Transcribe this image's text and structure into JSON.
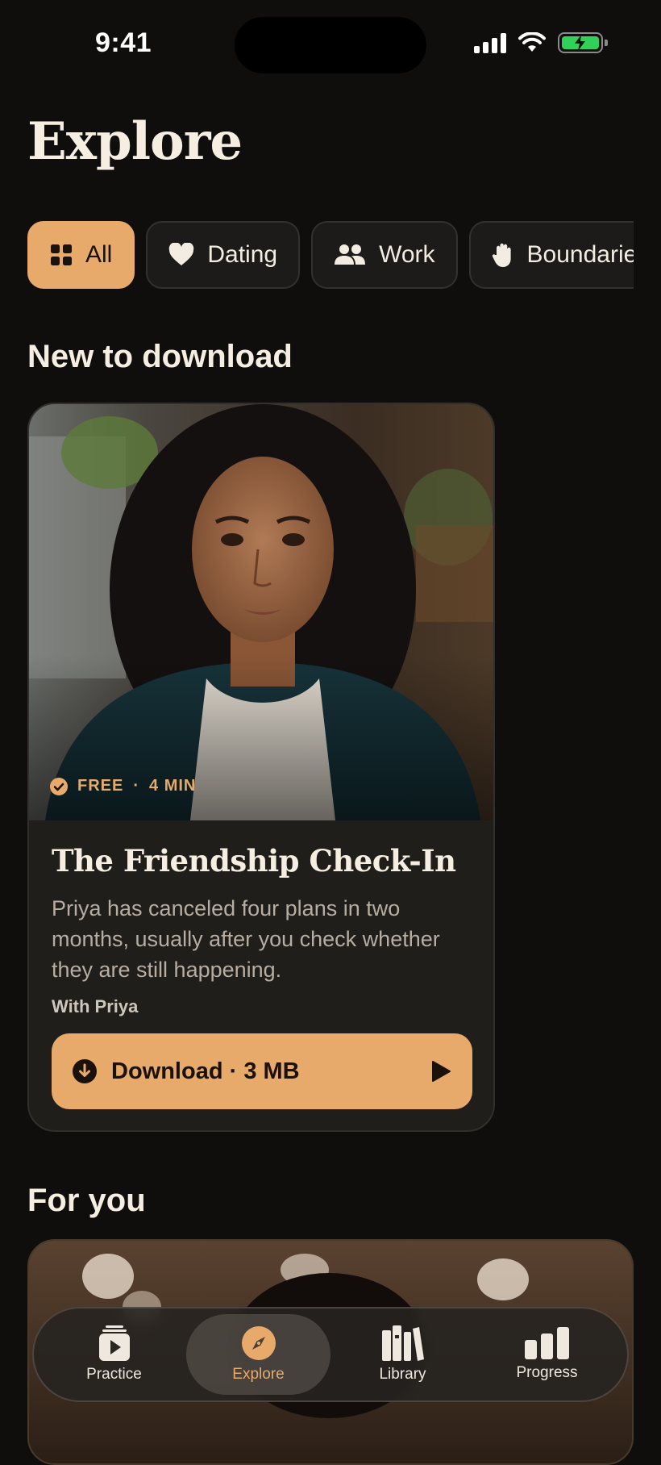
{
  "status": {
    "time": "9:41"
  },
  "page": {
    "title": "Explore"
  },
  "filters": [
    {
      "label": "All",
      "icon": "grid-icon",
      "active": true
    },
    {
      "label": "Dating",
      "icon": "heart-icon",
      "active": false
    },
    {
      "label": "Work",
      "icon": "people-icon",
      "active": false
    },
    {
      "label": "Boundaries",
      "icon": "hand-icon",
      "active": false
    }
  ],
  "sections": {
    "new_download": "New to download",
    "for_you": "For you"
  },
  "featured": {
    "meta_free": "FREE",
    "meta_sep": "·",
    "meta_duration": "4 MIN",
    "title": "The Friendship Check-In",
    "description": "Priya has canceled four plans in two months, usually after you check whether they are still happening.",
    "with": "With Priya",
    "download_label": "Download · 3 MB"
  },
  "tabs": [
    {
      "label": "Practice",
      "icon": "play-card-icon",
      "active": false
    },
    {
      "label": "Explore",
      "icon": "compass-icon",
      "active": true
    },
    {
      "label": "Library",
      "icon": "books-icon",
      "active": false
    },
    {
      "label": "Progress",
      "icon": "bar-chart-icon",
      "active": false
    }
  ],
  "colors": {
    "accent": "#e8aa6b",
    "background": "#0f0e0d",
    "card": "#201e1b"
  }
}
